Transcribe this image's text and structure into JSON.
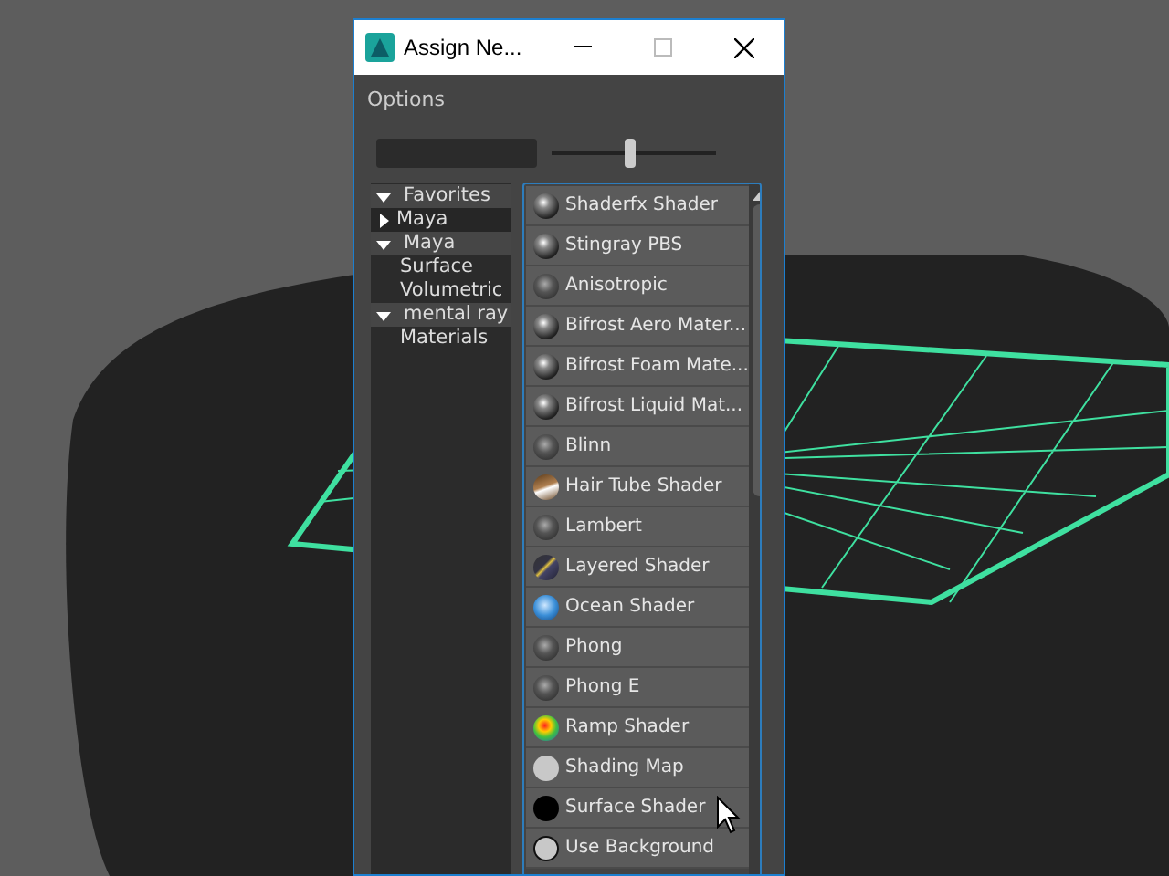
{
  "window": {
    "title": "Assign Ne..."
  },
  "menu": [
    "Options"
  ],
  "toolbar": {
    "slider": {
      "level": 0.48
    }
  },
  "tree": [
    {
      "label": "Favorites",
      "expanded": true,
      "children": [
        {
          "label": "Maya",
          "expanded": false
        }
      ]
    },
    {
      "label": "Maya",
      "expanded": true,
      "children": [
        {
          "label": "Surface"
        },
        {
          "label": "Volumetric"
        }
      ]
    },
    {
      "label": "mental ray",
      "expanded": true,
      "children": [
        {
          "label": "Materials"
        }
      ]
    }
  ],
  "shaders": [
    {
      "label": "Shaderfx Shader",
      "kind": "sphere"
    },
    {
      "label": "Stingray PBS",
      "kind": "sphere"
    },
    {
      "label": "Anisotropic",
      "kind": "dim"
    },
    {
      "label": "Bifrost Aero Mater...",
      "kind": "sphere"
    },
    {
      "label": "Bifrost Foam Mate...",
      "kind": "sphere"
    },
    {
      "label": "Bifrost Liquid Mat...",
      "kind": "sphere"
    },
    {
      "label": "Blinn",
      "kind": "dim"
    },
    {
      "label": "Hair Tube Shader",
      "kind": "hair"
    },
    {
      "label": "Lambert",
      "kind": "dim"
    },
    {
      "label": "Layered Shader",
      "kind": "layered"
    },
    {
      "label": "Ocean Shader",
      "kind": "ocean"
    },
    {
      "label": "Phong",
      "kind": "dim"
    },
    {
      "label": "Phong E",
      "kind": "dim"
    },
    {
      "label": "Ramp Shader",
      "kind": "ramp"
    },
    {
      "label": "Shading Map",
      "kind": "flat"
    },
    {
      "label": "Surface Shader",
      "kind": "black"
    },
    {
      "label": "Use Background",
      "kind": "outline"
    }
  ]
}
